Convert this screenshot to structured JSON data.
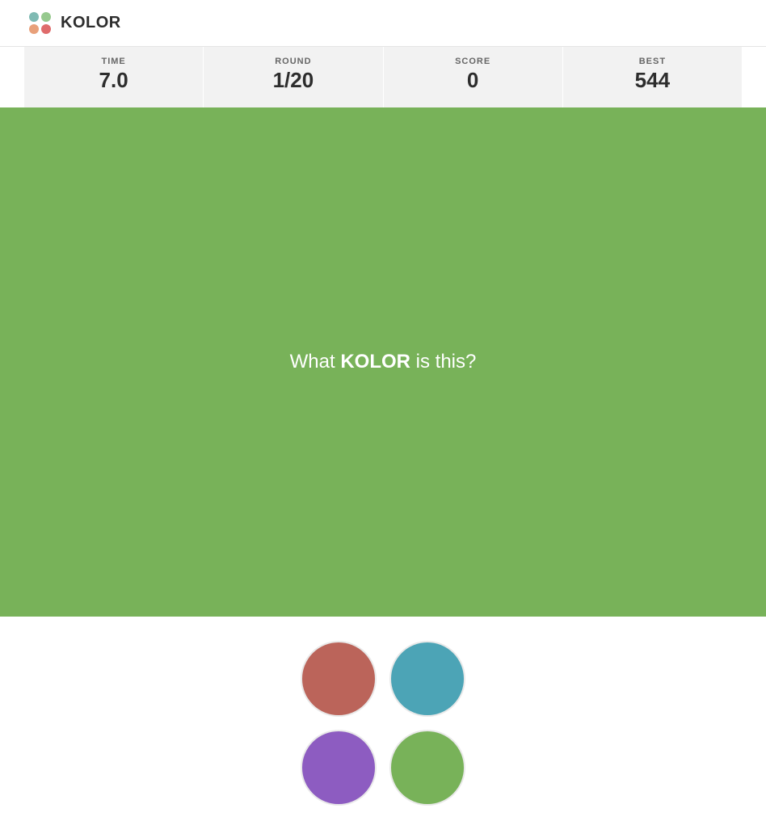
{
  "brand": "KOLOR",
  "logo_colors": {
    "teal": "#7fbab3",
    "green": "#96c98e",
    "orange": "#e8a07a",
    "red": "#df6b6b"
  },
  "stats": {
    "time": {
      "label": "TIME",
      "value": "7.0"
    },
    "round": {
      "label": "ROUND",
      "value": "1/20"
    },
    "score": {
      "label": "SCORE",
      "value": "0"
    },
    "best": {
      "label": "BEST",
      "value": "544"
    }
  },
  "target_color": "#78b259",
  "prompt": {
    "pre": "What ",
    "strong": "KOLOR",
    "post": " is this?"
  },
  "choices": [
    {
      "name": "choice-1",
      "color": "#bb645a"
    },
    {
      "name": "choice-2",
      "color": "#4ca4b6"
    },
    {
      "name": "choice-3",
      "color": "#8d5cc1"
    },
    {
      "name": "choice-4",
      "color": "#78b259"
    }
  ]
}
